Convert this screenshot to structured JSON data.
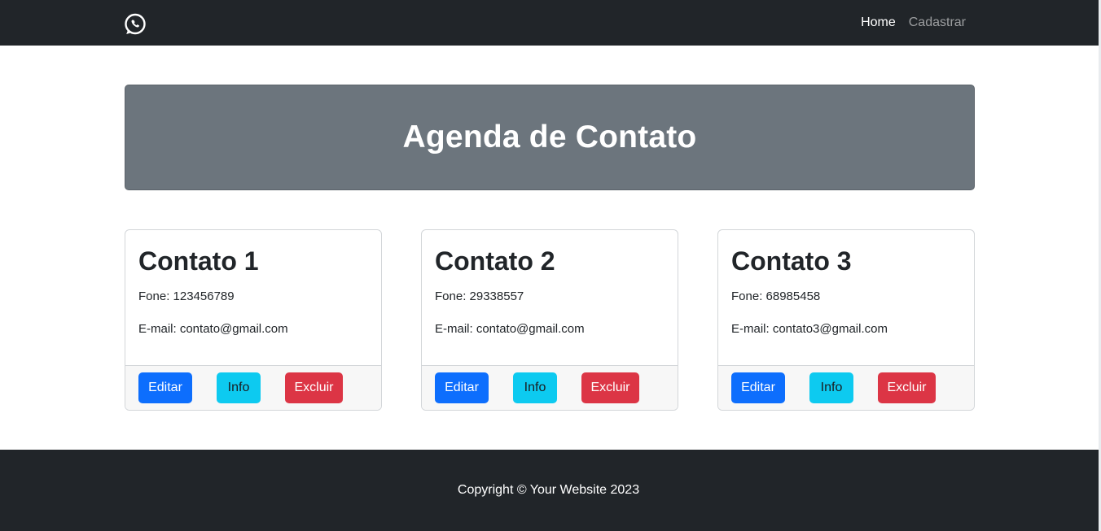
{
  "navbar": {
    "logo_icon": "whatsapp-icon",
    "links": [
      {
        "label": "Home",
        "active": true
      },
      {
        "label": "Cadastrar",
        "active": false
      }
    ]
  },
  "hero": {
    "title": "Agenda de Contato"
  },
  "contacts": [
    {
      "title": "Contato 1",
      "phone": "Fone: 123456789",
      "email": "E-mail: contato@gmail.com",
      "buttons": {
        "edit": "Editar",
        "info": "Info",
        "delete": "Excluir"
      }
    },
    {
      "title": "Contato 2",
      "phone": "Fone: 29338557",
      "email": "E-mail: contato@gmail.com",
      "buttons": {
        "edit": "Editar",
        "info": "Info",
        "delete": "Excluir"
      }
    },
    {
      "title": "Contato 3",
      "phone": "Fone: 68985458",
      "email": "E-mail: contato3@gmail.com",
      "buttons": {
        "edit": "Editar",
        "info": "Info",
        "delete": "Excluir"
      }
    }
  ],
  "footer": {
    "copyright": "Copyright © Your Website 2023"
  },
  "colors": {
    "navbar_bg": "#212529",
    "hero_bg": "#6c757d",
    "primary": "#0d6efd",
    "info": "#0dcaf0",
    "danger": "#dc3545"
  }
}
